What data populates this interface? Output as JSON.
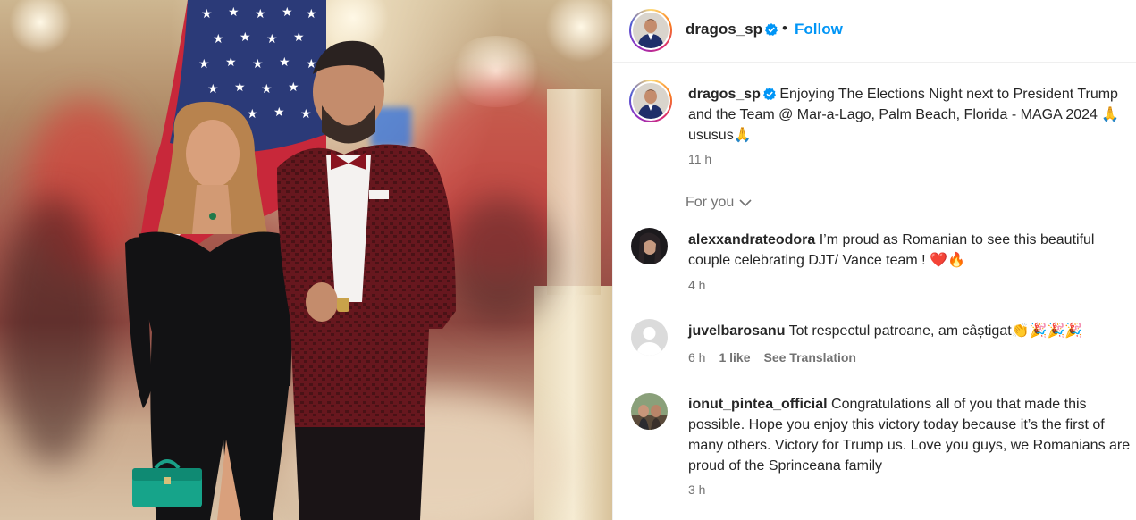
{
  "post": {
    "username": "dragos_sp",
    "verified": true,
    "follow_label": "Follow",
    "separator": "•",
    "caption_text": "Enjoying The Elections Night next to President Trump and the Team @ Mar-a-Lago, Palm Beach, Florida - MAGA 2024 🙏ususus🙏",
    "time": "11 h"
  },
  "sort": {
    "label": "For you",
    "icon": "chevron-down-icon"
  },
  "comments": [
    {
      "username": "alexxandrateodora",
      "text": "I’m proud as Romanian to see this beautiful couple celebrating DJT/ Vance team ! ❤️🔥",
      "time": "4 h",
      "likes": "",
      "translate": ""
    },
    {
      "username": "juvelbarosanu",
      "text": "Tot respectul patroane, am câștigat👏🎉🎉🎉",
      "time": "6 h",
      "likes": "1 like",
      "translate": "See Translation"
    },
    {
      "username": "ionut_pintea_official",
      "text": "Congratulations all of you that made this possible. Hope you enjoy this victory today because it’s the first of many others. Victory for Trump us. Love you guys, we Romanians are proud of the Sprinceana family",
      "time": "3 h",
      "likes": "",
      "translate": ""
    }
  ],
  "colors": {
    "link_blue": "#0095f6",
    "verified_blue": "#0095f6",
    "text": "#262626",
    "secondary": "#737373"
  }
}
